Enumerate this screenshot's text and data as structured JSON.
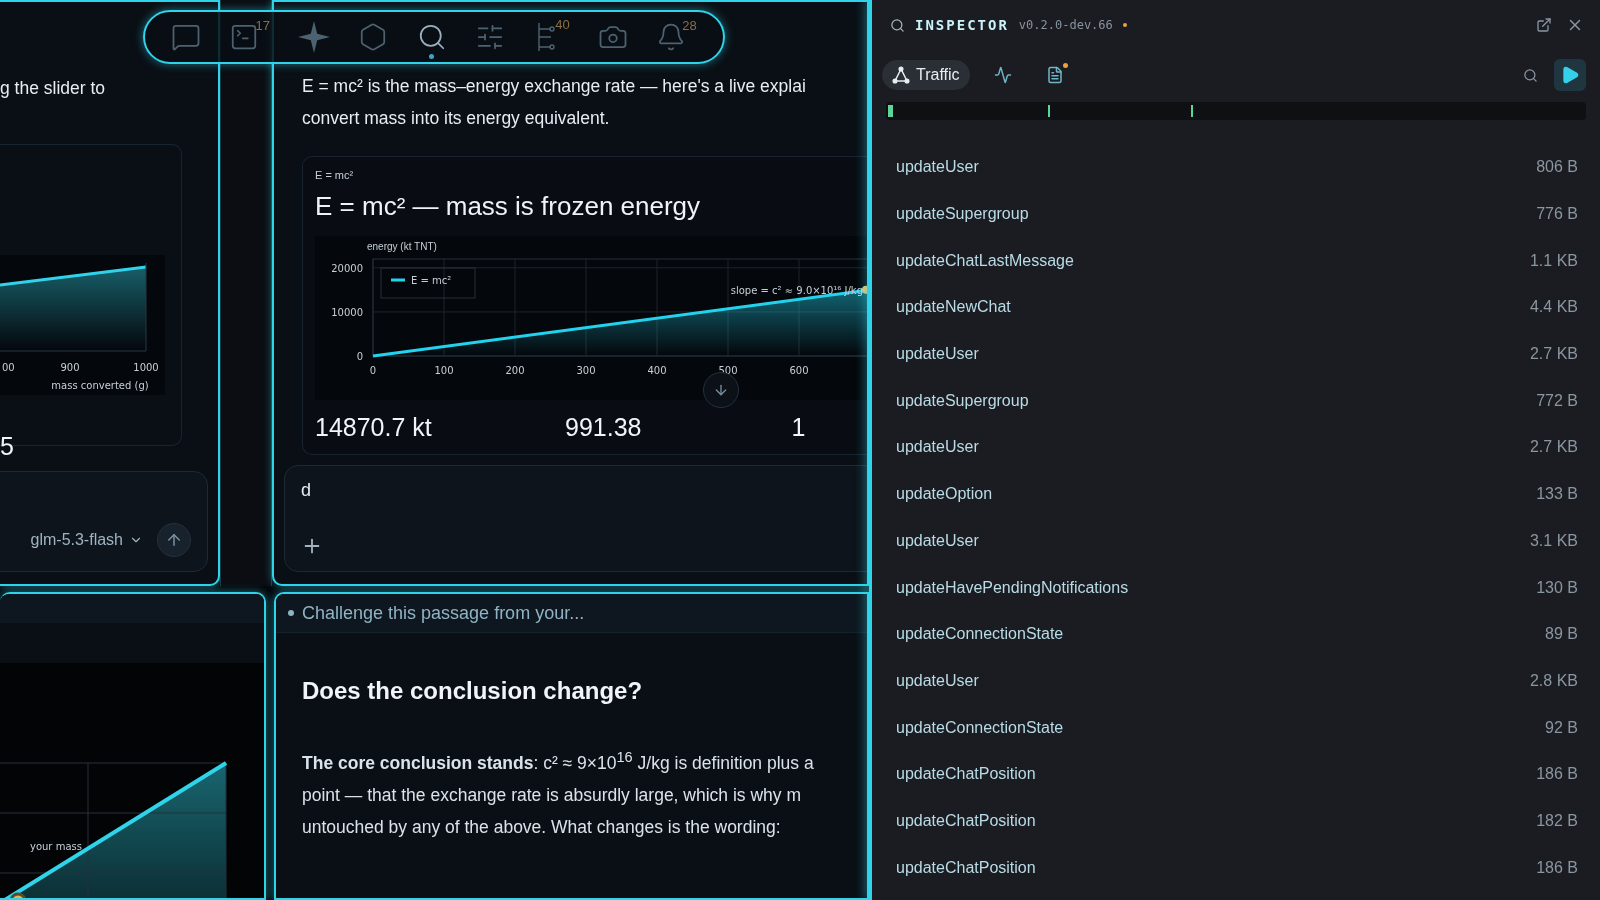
{
  "toolbar": {
    "tools": [
      {
        "kind": "chat",
        "selected": false
      },
      {
        "kind": "terminal",
        "badge": "17",
        "selected": false
      },
      {
        "kind": "sparkle",
        "selected": false
      },
      {
        "kind": "hexagon",
        "selected": false
      },
      {
        "kind": "search",
        "selected": true
      },
      {
        "kind": "sliders",
        "selected": false
      },
      {
        "kind": "branch",
        "badge": "40",
        "selected": false
      },
      {
        "kind": "camera",
        "selected": false
      },
      {
        "kind": "bell",
        "badge": "28",
        "selected": false
      }
    ]
  },
  "left_panel": {
    "text": "g the slider to",
    "chart": {
      "tick_labels": [
        "00",
        "900",
        "1000"
      ],
      "xlabel": "mass converted (g)"
    },
    "stat": "5",
    "composer": {
      "model": "glm-5.3-flash"
    }
  },
  "center_panel": {
    "intro": [
      "E = mc² is the mass–energy exchange rate — here's a live explai",
      "convert mass into its energy equivalent."
    ],
    "card": {
      "label": "E = mc²",
      "title": "E = mc² — mass is frozen energy",
      "chart_data": {
        "type": "line",
        "ylabel": "energy (kt TNT)",
        "x": [
          0,
          700
        ],
        "series": [
          {
            "name": "E = mc²",
            "color": "#22d3ee",
            "values": [
              0,
              15000
            ]
          }
        ],
        "xlim": [
          0,
          700
        ],
        "ylim": [
          0,
          22000
        ],
        "grid": true,
        "xticks": [
          0,
          100,
          200,
          300,
          400,
          500,
          600
        ],
        "yticks": [
          0,
          10000,
          20000
        ],
        "annotations": [
          {
            "text": "slope = c² ≈ 9.0×10¹⁶ J/kg"
          }
        ]
      },
      "stats": [
        "14870.7 kt",
        "991.38",
        "1"
      ]
    },
    "composer": {
      "value": "d"
    }
  },
  "bottom_left": {
    "chart_label": "your mass"
  },
  "bottom_right": {
    "header": "Challenge this passage from your...",
    "heading": "Does the conclusion change?",
    "paragraph_lines": [
      "**The core conclusion stands**: c² ≈ 9×10$^{16}$ J/kg is definition plus a",
      "point — that the exchange rate is absurdly large, which is why m",
      "untouched by any of the above. What changes is the wording:"
    ]
  },
  "inspector": {
    "title": "INSPECTOR",
    "version": "v0.2.0-dev.66",
    "tabs": [
      {
        "kind": "traffic",
        "label": "Traffic",
        "selected": true
      },
      {
        "kind": "pulse",
        "selected": false
      },
      {
        "kind": "log",
        "selected": false
      }
    ],
    "rows": [
      {
        "name": "updateUser",
        "size": "806 B"
      },
      {
        "name": "updateSupergroup",
        "size": "776 B"
      },
      {
        "name": "updateChatLastMessage",
        "size": "1.1 KB"
      },
      {
        "name": "updateNewChat",
        "size": "4.4 KB"
      },
      {
        "name": "updateUser",
        "size": "2.7 KB"
      },
      {
        "name": "updateSupergroup",
        "size": "772 B"
      },
      {
        "name": "updateUser",
        "size": "2.7 KB"
      },
      {
        "name": "updateOption",
        "size": "133 B"
      },
      {
        "name": "updateUser",
        "size": "3.1 KB"
      },
      {
        "name": "updateHavePendingNotifications",
        "size": "130 B"
      },
      {
        "name": "updateConnectionState",
        "size": "89 B"
      },
      {
        "name": "updateUser",
        "size": "2.8 KB"
      },
      {
        "name": "updateConnectionState",
        "size": "92 B"
      },
      {
        "name": "updateChatPosition",
        "size": "186 B"
      },
      {
        "name": "updateChatPosition",
        "size": "182 B"
      },
      {
        "name": "updateChatPosition",
        "size": "186 B"
      }
    ]
  }
}
